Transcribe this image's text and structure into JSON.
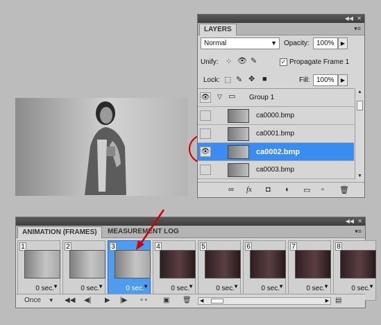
{
  "layers_panel": {
    "tab_label": "LAYERS",
    "blend_mode": "Normal",
    "opacity_label": "Opacity:",
    "opacity_value": "100%",
    "unify_label": "Unify:",
    "propagate_checked": true,
    "propagate_label": "Propagate Frame 1",
    "lock_label": "Lock:",
    "fill_label": "Fill:",
    "fill_value": "100%",
    "group_name": "Group 1",
    "layers": [
      {
        "name": "ca0000.bmp",
        "visible": false,
        "selected": false
      },
      {
        "name": "ca0001.bmp",
        "visible": false,
        "selected": false
      },
      {
        "name": "ca0002.bmp",
        "visible": true,
        "selected": true
      },
      {
        "name": "ca0003.bmp",
        "visible": false,
        "selected": false
      }
    ],
    "selection_color": "#3b8cf0"
  },
  "animation_panel": {
    "tab_active": "ANIMATION (FRAMES)",
    "tab_other": "MEASUREMENT LOG",
    "frames": [
      {
        "number": "1",
        "delay": "0 sec.",
        "selected": false,
        "tone": "light"
      },
      {
        "number": "2",
        "delay": "0 sec.",
        "selected": false,
        "tone": "light"
      },
      {
        "number": "3",
        "delay": "0 sec.",
        "selected": true,
        "tone": "light"
      },
      {
        "number": "4",
        "delay": "0 sec.",
        "selected": false,
        "tone": "dark"
      },
      {
        "number": "5",
        "delay": "0 sec.",
        "selected": false,
        "tone": "dark"
      },
      {
        "number": "6",
        "delay": "0 sec.",
        "selected": false,
        "tone": "dark"
      },
      {
        "number": "7",
        "delay": "0 sec.",
        "selected": false,
        "tone": "dark"
      },
      {
        "number": "8",
        "delay": "0 sec.",
        "selected": false,
        "tone": "dark"
      }
    ],
    "loop_option": "Once"
  },
  "annotation_color": "#d10000"
}
